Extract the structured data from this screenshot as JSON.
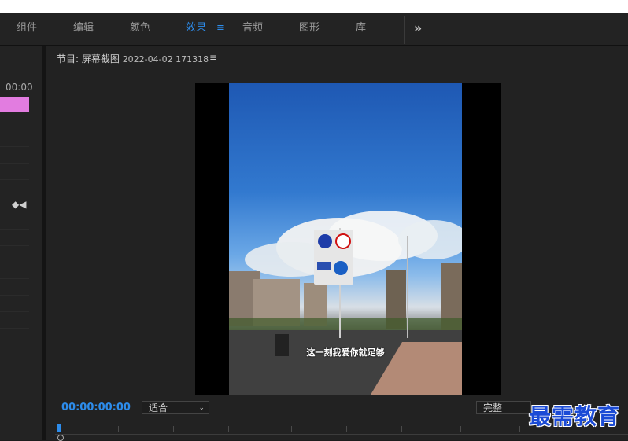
{
  "tabs": [
    {
      "label": "组件"
    },
    {
      "label": "编辑"
    },
    {
      "label": "颜色"
    },
    {
      "label": "效果",
      "active": true
    },
    {
      "label": "音频"
    },
    {
      "label": "图形"
    },
    {
      "label": "库"
    }
  ],
  "tab_menu_glyph": "≡",
  "overflow_glyph": "»",
  "left_panel": {
    "time": "00:00",
    "keyframe_glyph": "◆◀"
  },
  "program_monitor": {
    "title_prefix": "节目: 屏幕截图",
    "sequence_name": "2022-04-02 171318",
    "menu_glyph": "≡",
    "video_subtitle": "这一刻我爱你就足够",
    "timecode": "00:00:00:00",
    "zoom_select": "适合",
    "quality_select": "完整"
  },
  "watermark": "最需教育",
  "colors": {
    "accent": "#2d8ceb",
    "clip": "#e27ce0",
    "panel": "#232323"
  }
}
